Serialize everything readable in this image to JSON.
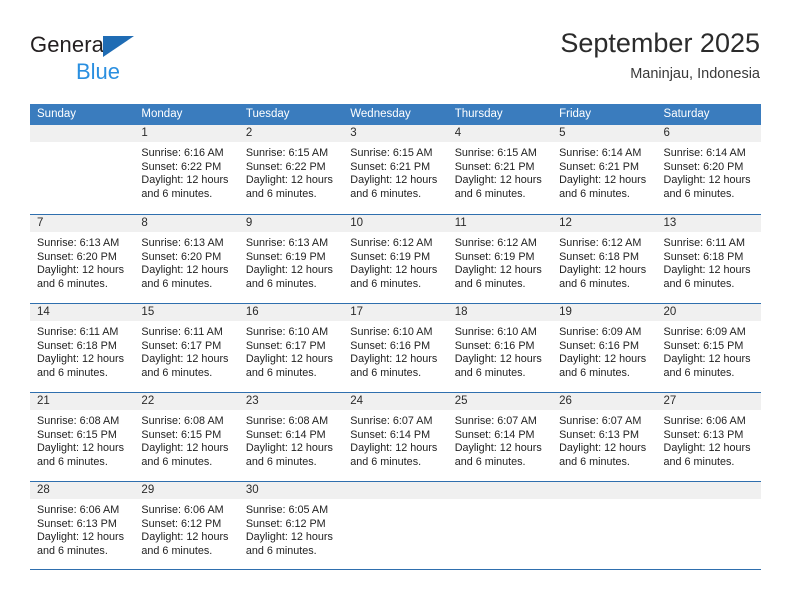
{
  "brand": {
    "name_part1": "General",
    "name_part2": "Blue",
    "triangle_color": "#1f6cb4",
    "blue_text_color": "#2a8fe0"
  },
  "header": {
    "title": "September 2025",
    "location": "Maninjau, Indonesia"
  },
  "theme": {
    "header_bg": "#3a7cbe",
    "row_divider": "#2f6fae",
    "daynum_band_bg": "#f0f0f0",
    "text": "#222222"
  },
  "calendar": {
    "weekday_headers": [
      "Sunday",
      "Monday",
      "Tuesday",
      "Wednesday",
      "Thursday",
      "Friday",
      "Saturday"
    ],
    "weeks": [
      [
        {
          "day": "",
          "lines": []
        },
        {
          "day": "1",
          "lines": [
            "Sunrise: 6:16 AM",
            "Sunset: 6:22 PM",
            "Daylight: 12 hours",
            "and 6 minutes."
          ]
        },
        {
          "day": "2",
          "lines": [
            "Sunrise: 6:15 AM",
            "Sunset: 6:22 PM",
            "Daylight: 12 hours",
            "and 6 minutes."
          ]
        },
        {
          "day": "3",
          "lines": [
            "Sunrise: 6:15 AM",
            "Sunset: 6:21 PM",
            "Daylight: 12 hours",
            "and 6 minutes."
          ]
        },
        {
          "day": "4",
          "lines": [
            "Sunrise: 6:15 AM",
            "Sunset: 6:21 PM",
            "Daylight: 12 hours",
            "and 6 minutes."
          ]
        },
        {
          "day": "5",
          "lines": [
            "Sunrise: 6:14 AM",
            "Sunset: 6:21 PM",
            "Daylight: 12 hours",
            "and 6 minutes."
          ]
        },
        {
          "day": "6",
          "lines": [
            "Sunrise: 6:14 AM",
            "Sunset: 6:20 PM",
            "Daylight: 12 hours",
            "and 6 minutes."
          ]
        }
      ],
      [
        {
          "day": "7",
          "lines": [
            "Sunrise: 6:13 AM",
            "Sunset: 6:20 PM",
            "Daylight: 12 hours",
            "and 6 minutes."
          ]
        },
        {
          "day": "8",
          "lines": [
            "Sunrise: 6:13 AM",
            "Sunset: 6:20 PM",
            "Daylight: 12 hours",
            "and 6 minutes."
          ]
        },
        {
          "day": "9",
          "lines": [
            "Sunrise: 6:13 AM",
            "Sunset: 6:19 PM",
            "Daylight: 12 hours",
            "and 6 minutes."
          ]
        },
        {
          "day": "10",
          "lines": [
            "Sunrise: 6:12 AM",
            "Sunset: 6:19 PM",
            "Daylight: 12 hours",
            "and 6 minutes."
          ]
        },
        {
          "day": "11",
          "lines": [
            "Sunrise: 6:12 AM",
            "Sunset: 6:19 PM",
            "Daylight: 12 hours",
            "and 6 minutes."
          ]
        },
        {
          "day": "12",
          "lines": [
            "Sunrise: 6:12 AM",
            "Sunset: 6:18 PM",
            "Daylight: 12 hours",
            "and 6 minutes."
          ]
        },
        {
          "day": "13",
          "lines": [
            "Sunrise: 6:11 AM",
            "Sunset: 6:18 PM",
            "Daylight: 12 hours",
            "and 6 minutes."
          ]
        }
      ],
      [
        {
          "day": "14",
          "lines": [
            "Sunrise: 6:11 AM",
            "Sunset: 6:18 PM",
            "Daylight: 12 hours",
            "and 6 minutes."
          ]
        },
        {
          "day": "15",
          "lines": [
            "Sunrise: 6:11 AM",
            "Sunset: 6:17 PM",
            "Daylight: 12 hours",
            "and 6 minutes."
          ]
        },
        {
          "day": "16",
          "lines": [
            "Sunrise: 6:10 AM",
            "Sunset: 6:17 PM",
            "Daylight: 12 hours",
            "and 6 minutes."
          ]
        },
        {
          "day": "17",
          "lines": [
            "Sunrise: 6:10 AM",
            "Sunset: 6:16 PM",
            "Daylight: 12 hours",
            "and 6 minutes."
          ]
        },
        {
          "day": "18",
          "lines": [
            "Sunrise: 6:10 AM",
            "Sunset: 6:16 PM",
            "Daylight: 12 hours",
            "and 6 minutes."
          ]
        },
        {
          "day": "19",
          "lines": [
            "Sunrise: 6:09 AM",
            "Sunset: 6:16 PM",
            "Daylight: 12 hours",
            "and 6 minutes."
          ]
        },
        {
          "day": "20",
          "lines": [
            "Sunrise: 6:09 AM",
            "Sunset: 6:15 PM",
            "Daylight: 12 hours",
            "and 6 minutes."
          ]
        }
      ],
      [
        {
          "day": "21",
          "lines": [
            "Sunrise: 6:08 AM",
            "Sunset: 6:15 PM",
            "Daylight: 12 hours",
            "and 6 minutes."
          ]
        },
        {
          "day": "22",
          "lines": [
            "Sunrise: 6:08 AM",
            "Sunset: 6:15 PM",
            "Daylight: 12 hours",
            "and 6 minutes."
          ]
        },
        {
          "day": "23",
          "lines": [
            "Sunrise: 6:08 AM",
            "Sunset: 6:14 PM",
            "Daylight: 12 hours",
            "and 6 minutes."
          ]
        },
        {
          "day": "24",
          "lines": [
            "Sunrise: 6:07 AM",
            "Sunset: 6:14 PM",
            "Daylight: 12 hours",
            "and 6 minutes."
          ]
        },
        {
          "day": "25",
          "lines": [
            "Sunrise: 6:07 AM",
            "Sunset: 6:14 PM",
            "Daylight: 12 hours",
            "and 6 minutes."
          ]
        },
        {
          "day": "26",
          "lines": [
            "Sunrise: 6:07 AM",
            "Sunset: 6:13 PM",
            "Daylight: 12 hours",
            "and 6 minutes."
          ]
        },
        {
          "day": "27",
          "lines": [
            "Sunrise: 6:06 AM",
            "Sunset: 6:13 PM",
            "Daylight: 12 hours",
            "and 6 minutes."
          ]
        }
      ],
      [
        {
          "day": "28",
          "lines": [
            "Sunrise: 6:06 AM",
            "Sunset: 6:13 PM",
            "Daylight: 12 hours",
            "and 6 minutes."
          ]
        },
        {
          "day": "29",
          "lines": [
            "Sunrise: 6:06 AM",
            "Sunset: 6:12 PM",
            "Daylight: 12 hours",
            "and 6 minutes."
          ]
        },
        {
          "day": "30",
          "lines": [
            "Sunrise: 6:05 AM",
            "Sunset: 6:12 PM",
            "Daylight: 12 hours",
            "and 6 minutes."
          ]
        },
        {
          "day": "",
          "lines": []
        },
        {
          "day": "",
          "lines": []
        },
        {
          "day": "",
          "lines": []
        },
        {
          "day": "",
          "lines": []
        }
      ]
    ]
  }
}
